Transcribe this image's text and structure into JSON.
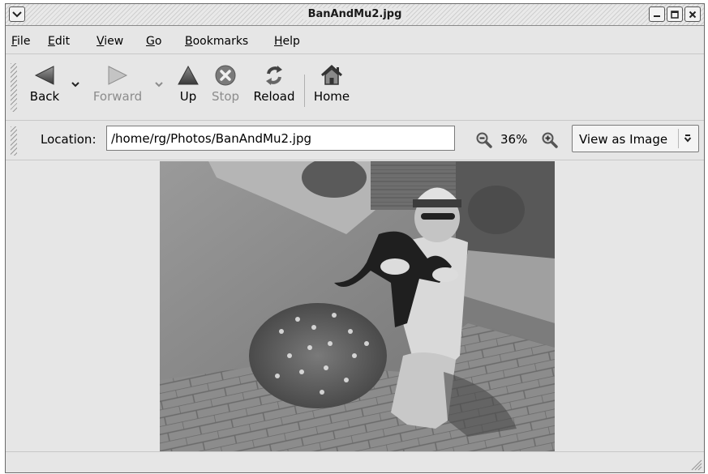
{
  "window": {
    "title": "BanAndMu2.jpg"
  },
  "menu": [
    {
      "label": "File",
      "mnemonic": "F",
      "rest": "ile"
    },
    {
      "label": "Edit",
      "mnemonic": "E",
      "rest": "dit"
    },
    {
      "label": "View",
      "mnemonic": "V",
      "rest": "iew"
    },
    {
      "label": "Go",
      "mnemonic": "G",
      "rest": "o"
    },
    {
      "label": "Bookmarks",
      "mnemonic": "B",
      "rest": "ookmarks"
    },
    {
      "label": "Help",
      "mnemonic": "H",
      "rest": "elp"
    }
  ],
  "toolbar": {
    "back_label": "Back",
    "forward_label": "Forward",
    "up_label": "Up",
    "stop_label": "Stop",
    "reload_label": "Reload",
    "home_label": "Home"
  },
  "location": {
    "label": "Location:",
    "value": "/home/rg/Photos/BanAndMu2.jpg",
    "zoom_level": "36%",
    "view_as": "View as Image"
  },
  "icons": {
    "window_menu": "window-menu-icon",
    "minimize": "minimize-icon",
    "maximize": "maximize-icon",
    "close": "close-icon",
    "back": "back-arrow-icon",
    "forward": "forward-arrow-icon",
    "up": "up-arrow-icon",
    "stop": "stop-icon",
    "reload": "reload-icon",
    "home": "home-icon",
    "zoom_out": "zoom-out-icon",
    "zoom_in": "zoom-in-icon"
  },
  "colors": {
    "window_bg": "#e6e6e6",
    "disabled_text": "#8c8c8c"
  }
}
